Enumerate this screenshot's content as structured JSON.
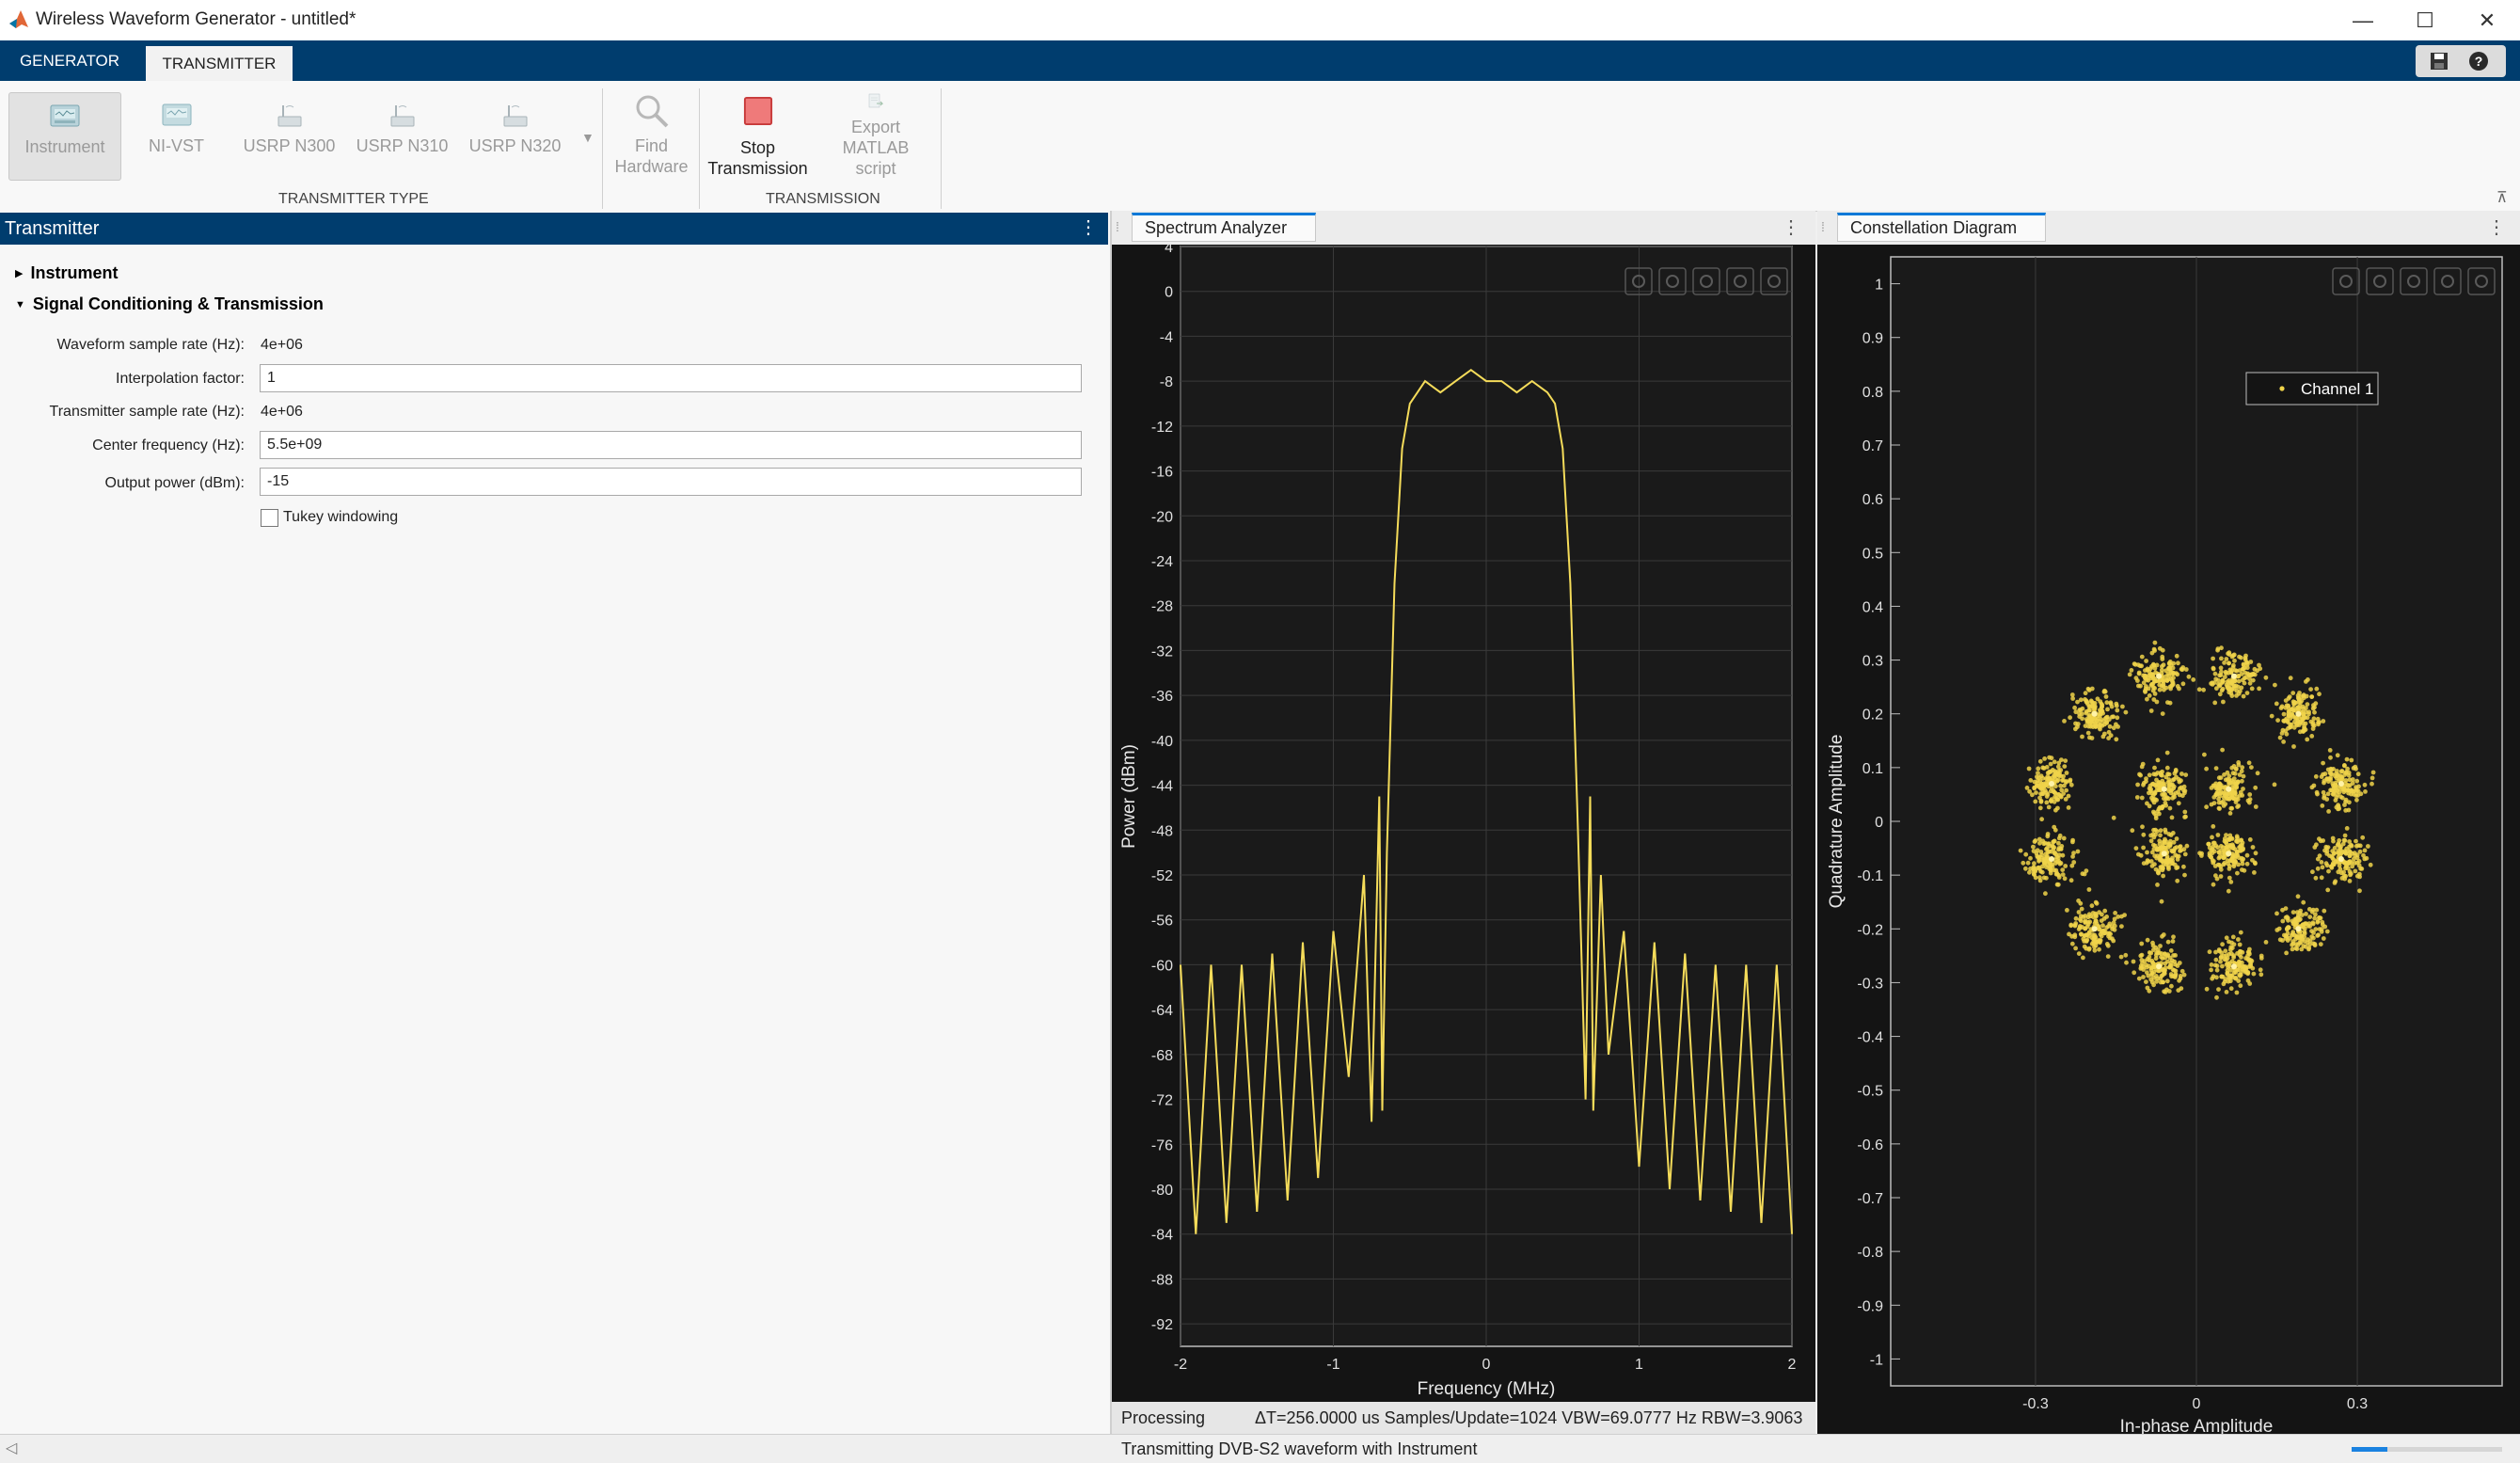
{
  "app": {
    "title": "Wireless Waveform Generator - untitled*"
  },
  "window_controls": {
    "minimize": "—",
    "maximize": "☐",
    "close": "✕"
  },
  "tabs": [
    {
      "label": "GENERATOR"
    },
    {
      "label": "TRANSMITTER"
    }
  ],
  "toolstrip": {
    "transmitter_types": [
      {
        "label": "Instrument"
      },
      {
        "label": "NI-VST"
      },
      {
        "label": "USRP N300"
      },
      {
        "label": "USRP N310"
      },
      {
        "label": "USRP N320"
      }
    ],
    "find_hardware": {
      "line1": "Find",
      "line2": "Hardware"
    },
    "stop_transmission": {
      "line1": "Stop",
      "line2": "Transmission"
    },
    "export_script": {
      "line1": "Export",
      "line2": "MATLAB script"
    },
    "sections": {
      "transmitter_type": "TRANSMITTER TYPE",
      "transmission": "TRANSMISSION"
    }
  },
  "transmitter_panel": {
    "title": "Transmitter",
    "instrument_node": "Instrument",
    "conditioning_node": "Signal Conditioning & Transmission",
    "fields": {
      "waveform_rate_label": "Waveform sample rate (Hz):",
      "waveform_rate_value": "4e+06",
      "interp_label": "Interpolation factor:",
      "interp_value": "1",
      "tx_rate_label": "Transmitter sample rate (Hz):",
      "tx_rate_value": "4e+06",
      "center_freq_label": "Center frequency (Hz):",
      "center_freq_value": "5.5e+09",
      "output_power_label": "Output power (dBm):",
      "output_power_value": "-15",
      "tukey_label": "Tukey windowing"
    }
  },
  "spectrum": {
    "tab": "Spectrum Analyzer",
    "status_state": "Processing",
    "status_stats": "ΔT=256.0000 us  Samples/Update=1024  VBW=69.0777 Hz  RBW=3.9063",
    "colors": {
      "trace": "#f5dc5a",
      "background": "#141414"
    }
  },
  "constellation": {
    "tab": "Constellation Diagram",
    "legend": "Channel 1"
  },
  "status_bar": {
    "message": "Transmitting DVB-S2 waveform with Instrument"
  },
  "chart_data": [
    {
      "type": "line",
      "xlabel": "Frequency (MHz)",
      "ylabel": "Power (dBm)",
      "xlim": [
        -2,
        2
      ],
      "ylim": [
        -94,
        4
      ],
      "xticks": [
        -2,
        -1,
        0,
        1,
        2
      ],
      "yticks": [
        4,
        0,
        -4,
        -8,
        -12,
        -16,
        -20,
        -24,
        -28,
        -32,
        -36,
        -40,
        -44,
        -48,
        -52,
        -56,
        -60,
        -64,
        -68,
        -72,
        -76,
        -80,
        -84,
        -88,
        -92
      ],
      "grid": true,
      "series": [
        {
          "x": [
            -2.0,
            -1.9,
            -1.8,
            -1.7,
            -1.6,
            -1.5,
            -1.4,
            -1.3,
            -1.2,
            -1.1,
            -1.0,
            -0.9,
            -0.8,
            -0.75,
            -0.7,
            -0.68,
            -0.65,
            -0.6,
            -0.55,
            -0.5,
            -0.45,
            -0.4,
            -0.3,
            -0.2,
            -0.1,
            0.0,
            0.1,
            0.2,
            0.3,
            0.4,
            0.45,
            0.5,
            0.55,
            0.6,
            0.65,
            0.68,
            0.7,
            0.75,
            0.8,
            0.9,
            1.0,
            1.1,
            1.2,
            1.3,
            1.4,
            1.5,
            1.6,
            1.7,
            1.8,
            1.9,
            2.0
          ],
          "y": [
            -60,
            -84,
            -60,
            -83,
            -60,
            -82,
            -59,
            -81,
            -58,
            -79,
            -57,
            -70,
            -52,
            -74,
            -45,
            -73,
            -50,
            -26,
            -14,
            -10,
            -9,
            -8,
            -9,
            -8,
            -7,
            -8,
            -8,
            -9,
            -8,
            -9,
            -10,
            -14,
            -26,
            -48,
            -72,
            -45,
            -73,
            -52,
            -68,
            -57,
            -78,
            -58,
            -80,
            -59,
            -81,
            -60,
            -82,
            -60,
            -83,
            -60,
            -84
          ]
        }
      ]
    },
    {
      "type": "scatter",
      "xlabel": "In-phase Amplitude",
      "ylabel": "Quadrature Amplitude",
      "xlim": [
        -0.57,
        0.57
      ],
      "ylim": [
        -1.05,
        1.05
      ],
      "xticks": [
        -0.3,
        0,
        0.3
      ],
      "yticks": [
        1,
        0.9,
        0.8,
        0.7,
        0.6,
        0.5,
        0.4,
        0.3,
        0.2,
        0.1,
        0,
        -0.1,
        -0.2,
        -0.3,
        -0.4,
        -0.5,
        -0.6,
        -0.7,
        -0.8,
        -0.9,
        -1
      ],
      "grid": true,
      "legend": "top-right",
      "series": [
        {
          "name": "Channel 1",
          "points": [
            [
              0.06,
              0.06
            ],
            [
              -0.06,
              0.06
            ],
            [
              -0.06,
              -0.06
            ],
            [
              0.06,
              -0.06
            ],
            [
              0.27,
              0.07
            ],
            [
              0.27,
              -0.07
            ],
            [
              0.19,
              0.2
            ],
            [
              0.07,
              0.27
            ],
            [
              -0.07,
              0.27
            ],
            [
              -0.19,
              0.2
            ],
            [
              -0.27,
              0.07
            ],
            [
              -0.27,
              -0.07
            ],
            [
              -0.19,
              -0.2
            ],
            [
              -0.07,
              -0.27
            ],
            [
              0.07,
              -0.27
            ],
            [
              0.19,
              -0.2
            ]
          ]
        }
      ]
    }
  ]
}
